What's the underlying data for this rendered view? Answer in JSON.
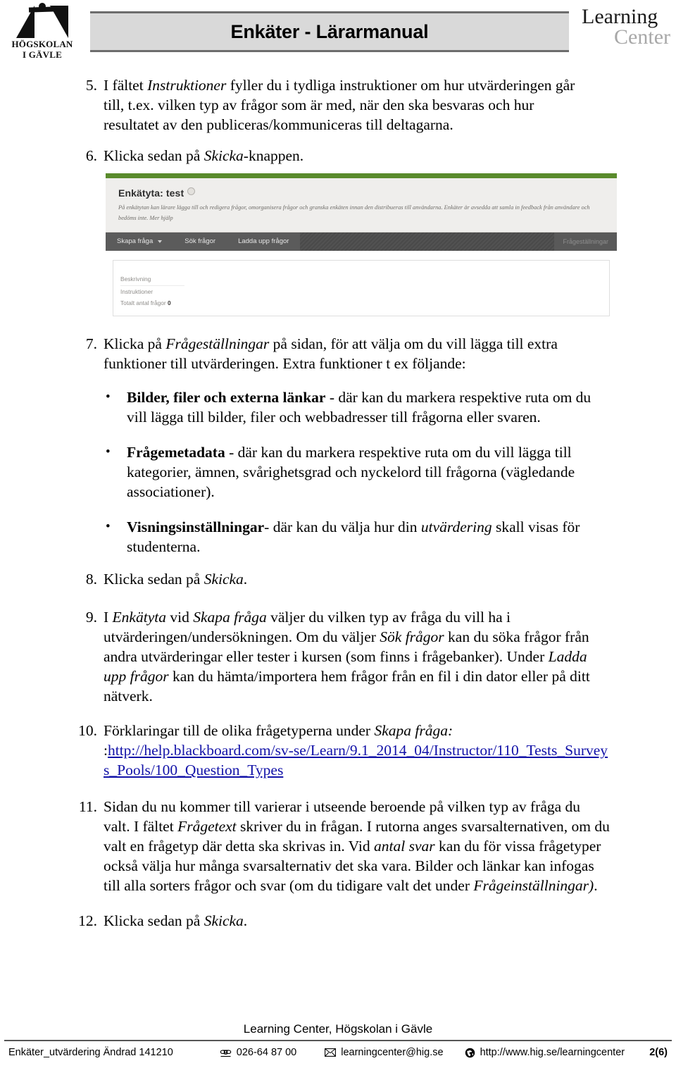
{
  "header": {
    "university_logo_line1": "HÖGSKOLAN",
    "university_logo_line2": "I GÄVLE",
    "doc_title": "Enkäter - Lärarmanual",
    "lc_logo_line1": "Learning",
    "lc_logo_line2": "Center"
  },
  "steps": {
    "s5": {
      "num": "5.",
      "p1": "I fältet ",
      "em1": "Instruktioner",
      "p2": " fyller du i tydliga instruktioner om hur utvärderingen går till, t.ex. vilken typ av frågor som är med, när den ska besvaras och hur resultatet av den publiceras/kommuniceras till deltagarna."
    },
    "s6": {
      "num": "6.",
      "p1": "Klicka sedan på ",
      "em1": "Skicka",
      "p2": "-knappen."
    },
    "s7": {
      "num": "7.",
      "p1": "Klicka på ",
      "em1": "Frågeställningar",
      "p2": " på sidan, för att välja om du vill lägga till extra funktioner till utvärderingen. Extra funktioner t ex följande:"
    },
    "s8": {
      "num": "8.",
      "p1": "Klicka sedan på ",
      "em1": "Skicka",
      "p2": "."
    },
    "s9": {
      "num": "9.",
      "p1": "I ",
      "em1": "Enkätyta",
      "p2": " vid ",
      "em2": "Skapa fråga",
      "p3": " väljer du vilken typ av fråga du vill ha i utvärderingen/undersökningen. Om du väljer ",
      "em3": "Sök frågor",
      "p4": " kan du söka frågor från andra utvärderingar eller tester i kursen (som finns i frågebanker). Under ",
      "em4": "Ladda upp frågor",
      "p5": " kan du hämta/importera hem frågor från en fil i din dator eller på ditt nätverk."
    },
    "s10": {
      "num": "10.",
      "p1": "Förklaringar till de olika frågetyperna under ",
      "em1": "Skapa fråga:",
      "p2": ":",
      "link": "http://help.blackboard.com/sv-se/Learn/9.1_2014_04/Instructor/110_Tests_Surveys_Pools/100_Question_Types"
    },
    "s11": {
      "num": "11.",
      "p1": "Sidan du nu kommer till varierar i utseende beroende på vilken typ av fråga du valt. I fältet ",
      "em1": "Frågetext",
      "p2": " skriver du in frågan. I rutorna anges svarsalternativen, om du valt en frågetyp där detta ska skrivas in. Vid ",
      "em2": "antal svar",
      "p3": " kan du för vissa frågetyper också välja hur många svarsalternativ det ska vara. Bilder och länkar kan infogas till alla sorters frågor och svar (om du tidigare valt det under ",
      "em3": "Frågeinställningar)",
      "p4": "."
    },
    "s12": {
      "num": "12.",
      "p1": "Klicka sedan på ",
      "em1": "Skicka",
      "p2": "."
    }
  },
  "bullets": [
    {
      "marker": "•",
      "bold": "Bilder, filer och externa länkar",
      "text": " - där kan du markera respektive ruta om du vill lägga till bilder, filer och webbadresser till frågorna eller svaren."
    },
    {
      "marker": "•",
      "bold": "Frågemetadata",
      "text": " - där kan du markera respektive ruta om du vill lägga till kategorier, ämnen, svårighetsgrad och nyckelord till frågorna (vägledande associationer)."
    },
    {
      "marker": "•",
      "bold": "Visningsinställningar",
      "text_a": "- där kan du välja hur din ",
      "em": "utvärdering",
      "text_b": " skall visas för studenterna."
    }
  ],
  "screenshot": {
    "hero_title": "Enkätyta: test",
    "hero_description": "På enkätytan kan lärare lägga till och redigera frågor, omorganisera frågor och granska enkäten innan den distribueras till användarna. Enkäter är avsedda att samla in feedback från användare och bedöms inte. Mer hjälp",
    "toolbar": {
      "create_question": "Skapa fråga",
      "search_questions": "Sök frågor",
      "upload_questions": "Ladda upp frågor",
      "question_settings": "Frågeställningar"
    },
    "panel": {
      "description_label": "Beskrivning",
      "instructions_label": "Instruktioner",
      "total_questions_label": "Totalt antal frågor",
      "total_questions_value": "0"
    },
    "accent_green": "#5a8b2c"
  },
  "footer": {
    "center_line": "Learning Center, Högskolan i Gävle",
    "doc_ref": "Enkäter_utvärdering Ändrad 141210",
    "phone": "026-64 87 00",
    "email": "learningcenter@hig.se",
    "website": "http://www.hig.se/learningcenter",
    "page_number": "2(6)",
    "phone_icon": "telephone-icon",
    "email_icon": "envelope-icon",
    "web_icon": "globe-icon"
  }
}
